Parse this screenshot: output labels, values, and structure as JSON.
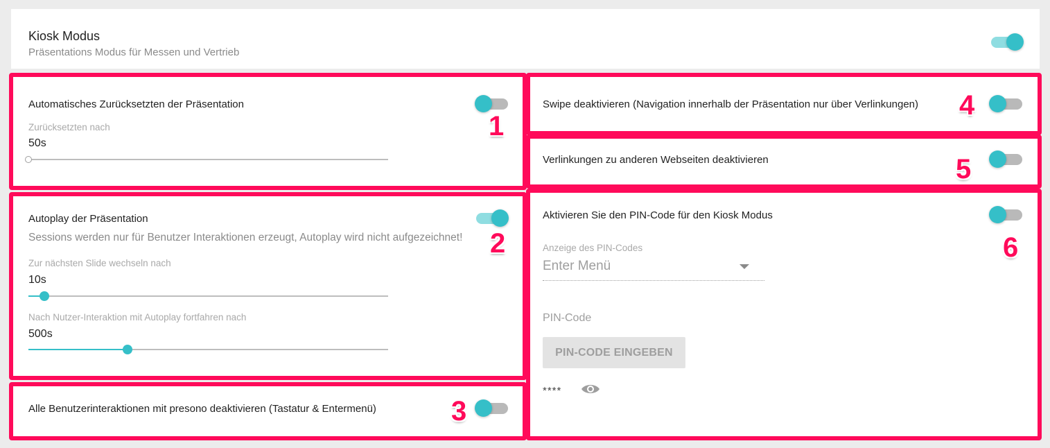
{
  "header": {
    "title": "Kiosk Modus",
    "subtitle": "Präsentations Modus für Messen und Vertrieb",
    "toggle_on": true
  },
  "section1": {
    "number": "1",
    "title": "Automatisches Zurücksetzten der Präsentation",
    "toggle_on": false,
    "slider_label": "Zurücksetzten nach",
    "slider_value": "50s",
    "slider_fraction": 0
  },
  "section2": {
    "number": "2",
    "title": "Autoplay der Präsentation",
    "description": "Sessions werden nur für Benutzer Interaktionen erzeugt, Autoplay wird nicht aufgezeichnet!",
    "toggle_on": true,
    "slider1_label": "Zur nächsten Slide wechseln nach",
    "slider1_value": "10s",
    "slider1_fraction": 0.044,
    "slider2_label": "Nach Nutzer-Interaktion mit Autoplay fortfahren nach",
    "slider2_value": "500s",
    "slider2_fraction": 0.275
  },
  "section3": {
    "number": "3",
    "title": "Alle Benutzerinteraktionen mit presono deaktivieren (Tastatur & Entermenü)",
    "toggle_on": false
  },
  "section4": {
    "number": "4",
    "title": "Swipe deaktivieren (Navigation innerhalb der Präsentation nur über Verlinkungen)",
    "toggle_on": false
  },
  "section5": {
    "number": "5",
    "title": "Verlinkungen zu anderen Webseiten deaktivieren",
    "toggle_on": false
  },
  "section6": {
    "number": "6",
    "title": "Aktivieren Sie den PIN-Code für den Kiosk Modus",
    "toggle_on": false,
    "select_label": "Anzeige des PIN-Codes",
    "select_value": "Enter Menü",
    "pin_label": "PIN-Code",
    "pin_button": "PIN-CODE EINGEBEN",
    "pin_masked": "****"
  },
  "colors": {
    "accent": "#35bfc8",
    "highlight": "#ff0a5a"
  },
  "icons": {
    "visibility": "eye-icon"
  }
}
